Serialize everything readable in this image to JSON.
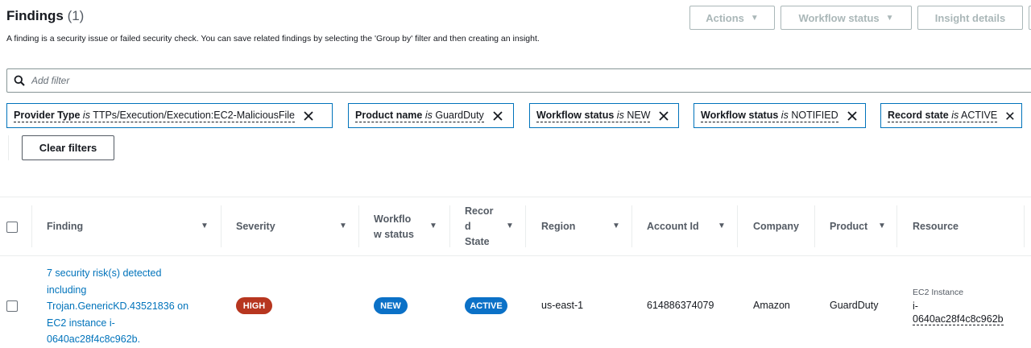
{
  "header": {
    "title": "Findings",
    "count": "(1)",
    "description": "A finding is a security issue or failed security check. You can save related findings by selecting the 'Group by' filter and then creating an insight."
  },
  "buttons": {
    "actions": "Actions",
    "workflow_status": "Workflow status",
    "insight_details": "Insight details",
    "clear_filters": "Clear filters"
  },
  "search": {
    "placeholder": "Add filter"
  },
  "filters": [
    {
      "field": "Provider Type",
      "op": "is",
      "value": "TTPs/Execution/Execution:EC2-MaliciousFile"
    },
    {
      "field": "Product name",
      "op": "is",
      "value": "GuardDuty"
    },
    {
      "field": "Workflow status",
      "op": "is",
      "value": "NEW"
    },
    {
      "field": "Workflow status",
      "op": "is",
      "value": "NOTIFIED"
    },
    {
      "field": "Record state",
      "op": "is",
      "value": "ACTIVE"
    }
  ],
  "columns": {
    "finding": "Finding",
    "severity": "Severity",
    "workflow_1": "Workflo",
    "workflow_2": "w status",
    "record_1": "Recor",
    "record_2": "d",
    "record_3": "State",
    "region": "Region",
    "account_id": "Account Id",
    "company": "Company",
    "product": "Product",
    "resource": "Resource"
  },
  "row": {
    "finding_lines": [
      "7 security risk(s) detected",
      "including",
      "Trojan.GenericKD.43521836 on",
      "EC2 instance i-",
      "0640ac28f4c8c962b."
    ],
    "severity": "HIGH",
    "workflow_status": "NEW",
    "record_state": "ACTIVE",
    "region": "us-east-1",
    "account_id": "614886374079",
    "company": "Amazon",
    "product": "GuardDuty",
    "resource_type": "EC2 Instance",
    "resource_id_1": "i-",
    "resource_id_2": "0640ac28f4c8c962b"
  },
  "colors": {
    "link": "#0073bb",
    "severity_high": "#b7361f",
    "status_blue": "#0b71c7",
    "chip_border": "#0073bb"
  }
}
